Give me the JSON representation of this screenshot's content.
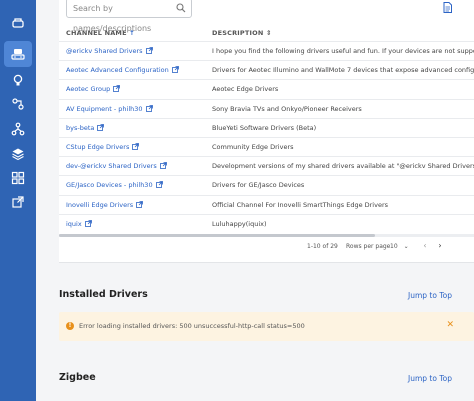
{
  "colors": {
    "sidebar": "#2f64b4",
    "sidebar_active": "#4f86d6",
    "link": "#2b63c5",
    "alert_bg": "#fdf3e1",
    "alert_accent": "#e8901a"
  },
  "sidebar": {
    "icons": [
      "hub-icon",
      "drivers-icon",
      "bulb-icon",
      "automation-icon",
      "network-icon",
      "package-icon",
      "grid-icon",
      "external-link-icon"
    ],
    "active_index": 1
  },
  "channels": {
    "search_placeholder": "Search by names/descriptions",
    "columns": {
      "name": "CHANNEL NAME",
      "description": "DESCRIPTION"
    },
    "rows": [
      {
        "name": "@erickv Shared Drivers",
        "description": "I hope you find the following drivers useful and fun. If your devices are not suppo"
      },
      {
        "name": "Aeotec Advanced Configuration",
        "description": "Drivers for Aeotec Illumino and WallMote 7 devices that expose advanced config"
      },
      {
        "name": "Aeotec Group",
        "description": "Aeotec Edge Drivers"
      },
      {
        "name": "AV Equipment - philh30",
        "description": "Sony Bravia TVs and Onkyo/Pioneer Receivers"
      },
      {
        "name": "bys-beta",
        "description": "BlueYeti Software Drivers (Beta)"
      },
      {
        "name": "CStup Edge Drivers",
        "description": "Community Edge Drivers"
      },
      {
        "name": "dev-@erickv Shared Drivers",
        "description": "Development versions of my shared drivers available at \"@erickv Shared Drivers\""
      },
      {
        "name": "GE/Jasco Devices - philh30",
        "description": "Drivers for GE/Jasco Devices"
      },
      {
        "name": "Inovelli Edge Drivers",
        "description": "Official Channel For Inovelli SmartThings Edge Drivers"
      },
      {
        "name": "iquix",
        "description": "Luluhappy(iquix)"
      }
    ],
    "pagination": {
      "range": "1-10 of 29",
      "rows_per_page_label": "Rows per page",
      "rows_per_page_value": "10"
    }
  },
  "installed": {
    "title": "Installed Drivers",
    "jump_label": "Jump to Top",
    "error_text": "Error loading installed drivers: 500 unsuccessful-http-call status=500"
  },
  "zigbee": {
    "title": "Zigbee",
    "jump_label": "Jump to Top"
  }
}
